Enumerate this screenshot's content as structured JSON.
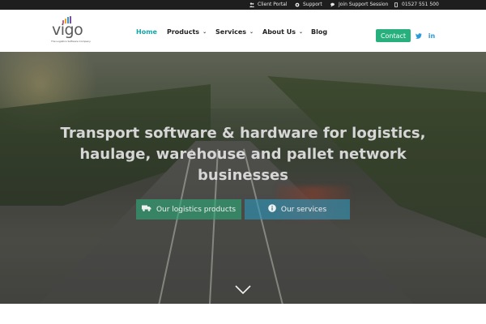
{
  "topbar": {
    "links": [
      {
        "label": "Client Portal",
        "icon": "users-icon"
      },
      {
        "label": "Support",
        "icon": "gear-icon"
      },
      {
        "label": "Join Support Session",
        "icon": "chat-icon"
      },
      {
        "label": "01527 551 500",
        "icon": "phone-icon"
      }
    ]
  },
  "logo": {
    "text": "vigo",
    "tagline": "The Logistics Software Company",
    "bar_colors": [
      "#e84c8b",
      "#f5a623",
      "#2a9bd8",
      "#7b4fa0"
    ]
  },
  "nav": {
    "items": [
      {
        "label": "Home",
        "active": true,
        "dropdown": false
      },
      {
        "label": "Products",
        "active": false,
        "dropdown": true
      },
      {
        "label": "Services",
        "active": false,
        "dropdown": true
      },
      {
        "label": "About Us",
        "active": false,
        "dropdown": true
      },
      {
        "label": "Blog",
        "active": false,
        "dropdown": false
      }
    ],
    "contact_label": "Contact",
    "social": [
      {
        "name": "twitter-icon",
        "glyph": "🐦"
      },
      {
        "name": "linkedin-icon",
        "glyph": "in"
      }
    ]
  },
  "hero": {
    "headline": "Transport software & hardware for logistics, haulage, warehouse and pallet network businesses",
    "buttons": [
      {
        "label": "Our logistics products",
        "icon": "truck-icon"
      },
      {
        "label": "Our services",
        "icon": "info-icon"
      }
    ],
    "scroll_icon": "chevron-down-icon"
  },
  "colors": {
    "accent": "#17a5a5",
    "contact_bg": "#27b07d",
    "btn_green": "#2daa78",
    "btn_blue": "#2d96b9",
    "social": "#2a9bd8"
  }
}
